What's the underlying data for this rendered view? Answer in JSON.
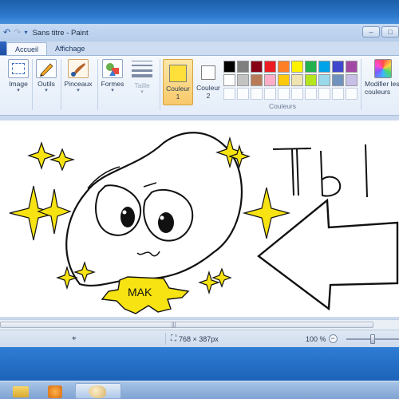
{
  "window": {
    "title": "Sans titre - Paint",
    "controls": [
      "–",
      "□",
      "✕"
    ]
  },
  "quick_access": [
    "undo-icon",
    "redo-icon",
    "customize-arrow-icon"
  ],
  "tabs": [
    {
      "label": "Accueil",
      "active": true
    },
    {
      "label": "Affichage",
      "active": false
    }
  ],
  "ribbon": {
    "image_label": "Image",
    "outils_label": "Outils",
    "pinceaux_label": "Pinceaux",
    "formes_label": "Formes",
    "taille_label": "Taille",
    "couleur1_label": "Couleur 1",
    "couleur2_label": "Couleur 2",
    "couleurs_group": "Couleurs",
    "modifier_label": "Modifier les couleurs",
    "couleur1_value": "#ffe03a",
    "couleur2_value": "#ffffff"
  },
  "palette": [
    "#000000",
    "#7f7f7f",
    "#880015",
    "#ed1c24",
    "#ff7f27",
    "#fff200",
    "#22b14c",
    "#00a2e8",
    "#3f48cc",
    "#a349a4",
    "#ffffff",
    "#c3c3c3",
    "#b97a57",
    "#ffaec9",
    "#ffc90e",
    "#efe4b0",
    "#b5e61d",
    "#99d9ea",
    "#7092be",
    "#c8bfe7",
    "",
    "",
    "",
    "",
    "",
    "",
    "",
    "",
    "",
    ""
  ],
  "status": {
    "dimensions": "768 × 387px",
    "zoom": "100 %",
    "zoom_level_fraction": 0.5
  },
  "drawing": {
    "text_tbl": "Tbl",
    "text_mak": "MAK",
    "yellow": "#f7e312"
  }
}
